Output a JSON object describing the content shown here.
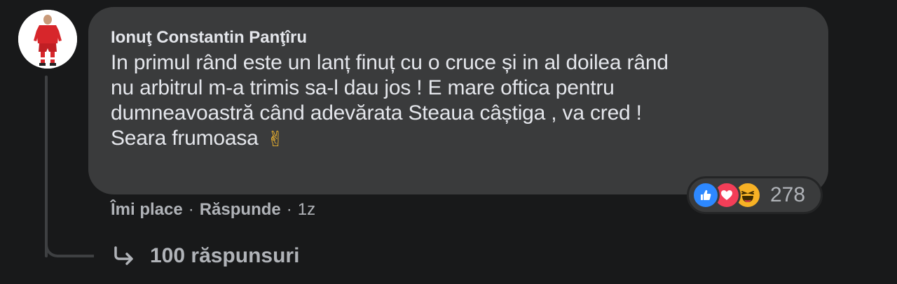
{
  "comment": {
    "author": "Ionuţ Constantin Panţîru",
    "lines": [
      "In primul rând este un lanț finuț cu o cruce și in al doilea rând",
      "nu arbitrul m-a trimis sa-l dau jos ! E mare oftica pentru",
      "dumneavoastră când adevărata Steaua câștiga , va cred !",
      "Seara frumoasa"
    ],
    "emoji": "✌",
    "emoji_icon": "victory-hand-icon"
  },
  "reactions": {
    "icons": [
      "like-icon",
      "love-icon",
      "haha-icon"
    ],
    "count": "278",
    "colors": {
      "like": "#2d88ff",
      "love": "#f33e58",
      "haha": "#f7b125"
    }
  },
  "actions": {
    "like_label": "Îmi place",
    "reply_label": "Răspunde",
    "separator": "·",
    "time": "1z"
  },
  "replies": {
    "label": "100 răspunsuri"
  },
  "theme": {
    "background": "#18191a",
    "bubble": "#3a3b3c",
    "text_primary": "#e4e6eb",
    "text_secondary": "#b0b3b8"
  }
}
